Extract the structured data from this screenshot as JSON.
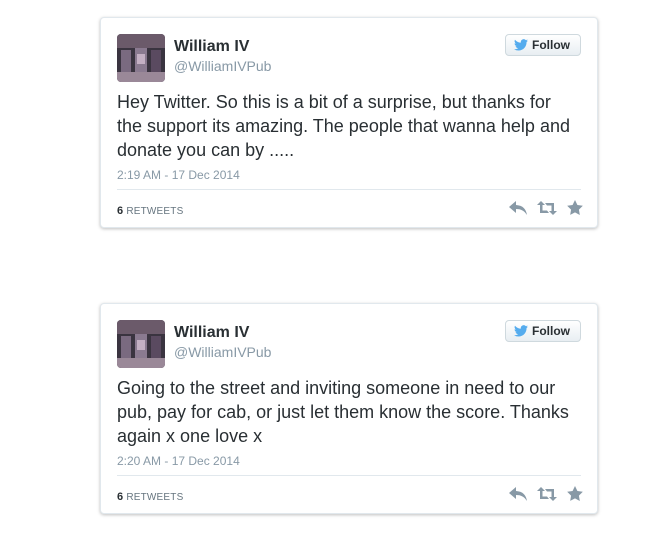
{
  "colors": {
    "border": "#e1e8ed",
    "name": "#292f33",
    "muted": "#8899a6",
    "twitter_blue": "#55acee",
    "action_gray": "#8899a6"
  },
  "tweets": [
    {
      "name": "William IV",
      "handle": "@WilliamIVPub",
      "follow_label": "Follow",
      "text": "Hey Twitter. So this is a bit of a surprise, but thanks for the support its amazing. The people that wanna help and donate you can by .....",
      "timestamp": "2:19 AM - 17 Dec 2014",
      "retweet_count": "6",
      "retweet_label": "RETWEETS",
      "icons": [
        "reply-icon",
        "retweet-icon",
        "favorite-icon",
        "twitter-bird-icon"
      ]
    },
    {
      "name": "William IV",
      "handle": "@WilliamIVPub",
      "follow_label": "Follow",
      "text": "Going to the street and inviting someone in need to our pub, pay for cab, or just let them know the score. Thanks again x one love x",
      "timestamp": "2:20 AM - 17 Dec 2014",
      "retweet_count": "6",
      "retweet_label": "RETWEETS",
      "icons": [
        "reply-icon",
        "retweet-icon",
        "favorite-icon",
        "twitter-bird-icon"
      ]
    }
  ]
}
